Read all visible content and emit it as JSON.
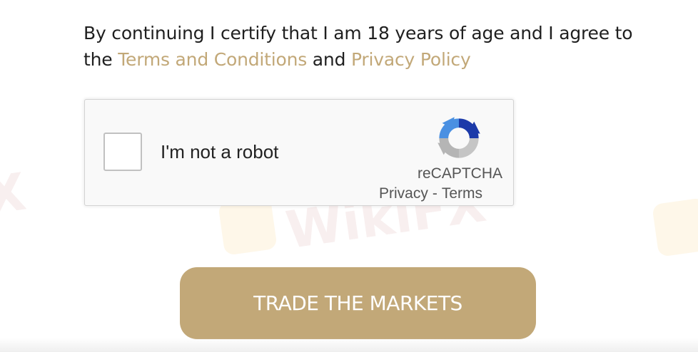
{
  "consent": {
    "text_before": "By continuing I certify that I am 18 years of age and I agree to the ",
    "terms_link": "Terms and Conditions",
    "text_middle": " and ",
    "privacy_link": "Privacy Policy"
  },
  "recaptcha": {
    "checkbox_label": "I'm not a robot",
    "brand": "reCAPTCHA",
    "privacy_link": "Privacy",
    "separator": "-",
    "terms_link": "Terms",
    "icon": "recaptcha-logo-icon"
  },
  "cta": {
    "label": "TRADE THE MARKETS"
  },
  "watermark": {
    "text": "WikiFX",
    "partial_text": "X"
  },
  "colors": {
    "accent": "#c2a878",
    "text": "#1f1f1f",
    "recaptcha_bg": "#f9f9f9",
    "recaptcha_border": "#d3d3d3"
  }
}
